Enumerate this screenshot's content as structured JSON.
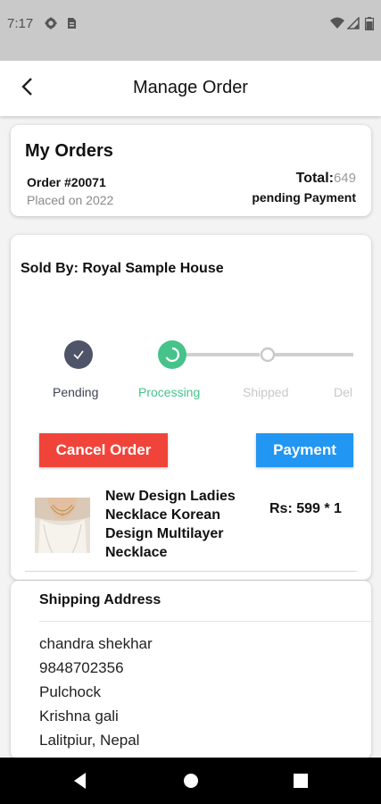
{
  "status_bar": {
    "time": "7:17",
    "left_icons": [
      "gear-icon",
      "sim-card-icon"
    ],
    "right_icons": [
      "wifi-icon",
      "signal-icon",
      "battery-icon"
    ]
  },
  "app_bar": {
    "title": "Manage Order",
    "back_icon": "chevron-left-icon"
  },
  "orders_card": {
    "title": "My Orders",
    "order_number": "Order #20071",
    "placed_on": "Placed on 2022",
    "total_label": "Total:",
    "total_value": "649",
    "payment_status": "pending Payment"
  },
  "seller_card": {
    "sold_by": "Sold By: Royal Sample House",
    "steps": [
      {
        "label": "Pending",
        "state": "done"
      },
      {
        "label": "Processing",
        "state": "active"
      },
      {
        "label": "Shipped",
        "state": "upcoming"
      },
      {
        "label": "Del",
        "state": "upcoming"
      }
    ],
    "cancel_label": "Cancel Order",
    "payment_label": "Payment",
    "product": {
      "name": "New Design Ladies Necklace Korean Design Multilayer Necklace",
      "price": "Rs: 599 * 1",
      "thumbnail": "necklace-photo"
    }
  },
  "address_card": {
    "title": "Shipping Address",
    "lines": [
      "chandra shekhar",
      "9848702356",
      "Pulchock",
      "Krishna gali",
      "Lalitpiur, Nepal"
    ]
  },
  "nav_bar": {
    "buttons": [
      "back-triangle-icon",
      "home-circle-icon",
      "recents-square-icon"
    ]
  },
  "colors": {
    "status_bar_bg": "#c9c9c9",
    "step_done": "#4f5468",
    "step_active": "#46c28b",
    "step_upcoming": "#c8c8c8",
    "cancel_button": "#f0443a",
    "payment_button": "#2196f3"
  }
}
